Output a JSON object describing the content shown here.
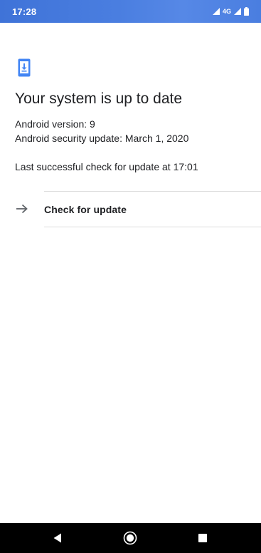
{
  "status_bar": {
    "time": "17:28",
    "network_label": "4G",
    "icons": [
      "signal-icon",
      "network-4g-icon",
      "signal-icon",
      "battery-icon"
    ],
    "background_color": "#4a7ee0"
  },
  "update_screen": {
    "header_icon": "phone-update-icon",
    "title": "Your system is up to date",
    "android_version": "Android version: 9",
    "security_update": "Android security update: March 1, 2020",
    "last_check": "Last successful check for update at 17:01",
    "check_button": {
      "icon": "arrow-right-icon",
      "label": "Check for update"
    },
    "accent_color": "#4285f4"
  },
  "nav_bar": {
    "buttons": [
      "back-icon",
      "home-icon",
      "recents-icon"
    ],
    "background_color": "#000000"
  }
}
